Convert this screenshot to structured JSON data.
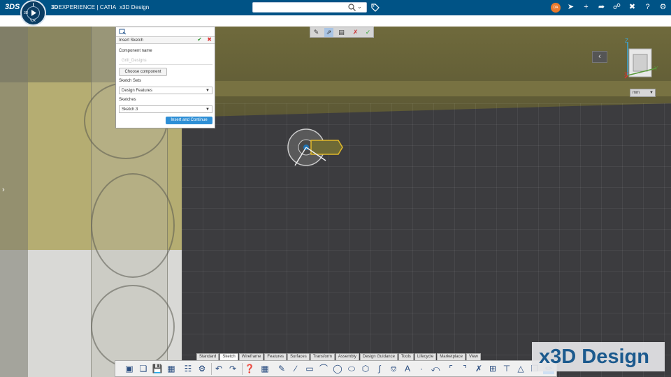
{
  "app": {
    "brand_prefix": "3D",
    "brand_mid": "EXPERIENCE | CATIA",
    "brand_app": "x3D Design",
    "compass_labels": [
      "3D",
      "V,R"
    ],
    "user_initials": "DA"
  },
  "topbar_icons": [
    "share-icon",
    "add-icon",
    "forward-icon",
    "network-icon",
    "tools-icon",
    "help-icon",
    "settings-icon"
  ],
  "context_toolbar": {
    "icons": [
      "sketch-icon",
      "pointer-icon",
      "constraint-icon",
      "exit-icon",
      "validate-icon"
    ]
  },
  "insert_sketch_panel": {
    "title": "Insert Sketch",
    "component_label": "Component name",
    "component_placeholder": "Grill_Designs",
    "choose_button": "Choose component",
    "sketch_sets_label": "Sketch Sets",
    "sketch_sets_value": "Design Features",
    "sketches_label": "Sketches",
    "sketches_value": "Sketch.3",
    "primary_button": "Insert and Continue"
  },
  "view": {
    "unit_value": "mm",
    "axes": [
      "Z",
      "Y",
      "X"
    ]
  },
  "tabs": [
    {
      "label": "Standard",
      "active": false
    },
    {
      "label": "Sketch",
      "active": true
    },
    {
      "label": "Wireframe",
      "active": false
    },
    {
      "label": "Features",
      "active": false
    },
    {
      "label": "Surfaces",
      "active": false
    },
    {
      "label": "Transform",
      "active": false
    },
    {
      "label": "Assembly",
      "active": false
    },
    {
      "label": "Design Guidance",
      "active": false
    },
    {
      "label": "Tools",
      "active": false
    },
    {
      "label": "Lifecycle",
      "active": false
    },
    {
      "label": "Marketplace",
      "active": false
    },
    {
      "label": "View",
      "active": false
    }
  ],
  "watermark": "x3D Design",
  "colors": {
    "topbar": "#005386",
    "accent": "#2e8fd6",
    "highlight": "#e0b82a"
  }
}
